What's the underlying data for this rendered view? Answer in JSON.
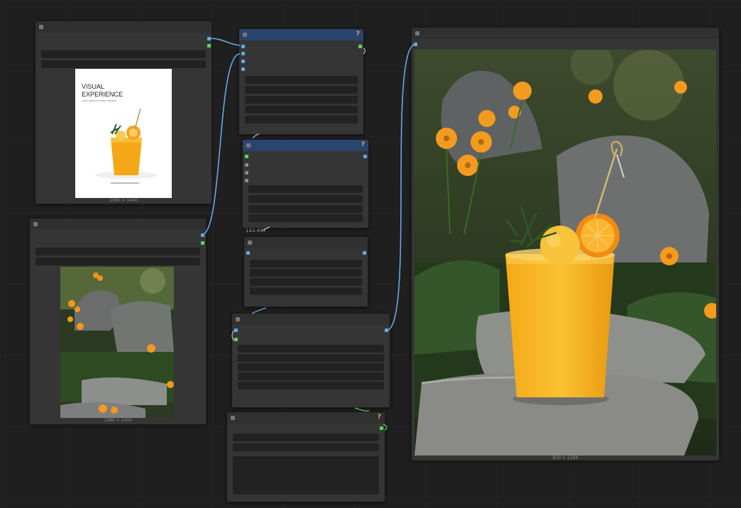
{
  "canvas": {
    "background": "#1f1f1f",
    "wire_color": "#64a8e8",
    "node_color": "#353535",
    "header_blue": "#2a4470",
    "help_color": "#e8b53a"
  },
  "nodes": {
    "load_image_ref": {
      "preview_title": "VISUAL",
      "preview_title2": "EXPERIENCE",
      "preview_tagline": "LIGHT DELIGHTS EVERY SEASON",
      "size_label": "1080 × 1440"
    },
    "load_image_scene": {
      "size_label": "1080 × 1430"
    },
    "sampler_a": {
      "help_icon": "question-mark-icon",
      "help_text": "?"
    },
    "sampler_b": {
      "help_icon": "question-mark-icon",
      "help_text": "?"
    },
    "value_node": {
      "value_text": "143.497"
    },
    "bottom_node": {
      "help_icon": "question-mark-icon",
      "help_text": "?"
    },
    "preview_output": {
      "size_label": "830 × 1184"
    }
  }
}
